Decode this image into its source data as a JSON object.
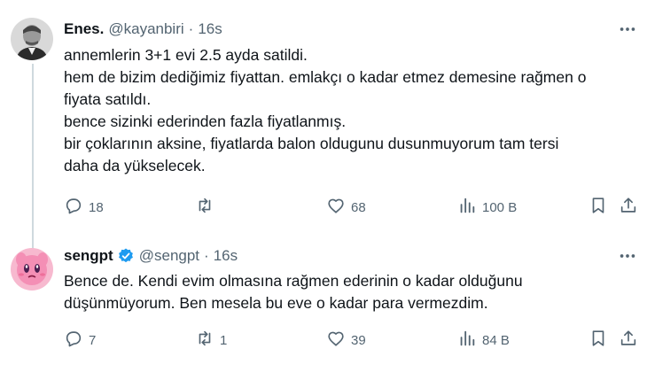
{
  "tweets": [
    {
      "name": "Enes.",
      "handle": "@kayanbiri",
      "separator": "·",
      "time": "16s",
      "lines": [
        "annemlerin 3+1 evi 2.5 ayda satildi.",
        "hem de bizim dediğimiz fiyattan. emlakçı o kadar etmez demesine rağmen o",
        "fiyata satıldı.",
        "bence sizinki ederinden fazla fiyatlanmış.",
        "bir çoklarının aksine, fiyatlarda balon oldugunu dusunmuyorum tam tersi",
        "daha da yükselecek."
      ],
      "replies": "18",
      "retweets": "",
      "likes": "68",
      "views": "100 B"
    },
    {
      "name": "sengpt",
      "verified": true,
      "handle": "@sengpt",
      "separator": "·",
      "time": "16s",
      "lines": [
        "Bence de. Kendi evim olmasına rağmen ederinin o kadar olduğunu",
        "düşünmüyorum. Ben mesela bu eve o kadar para vermezdim."
      ],
      "replies": "7",
      "retweets": "1",
      "likes": "39",
      "views": "84 B"
    }
  ],
  "icons": {
    "more": "more-dots-icon",
    "reply": "reply-icon",
    "retweet": "retweet-icon",
    "like": "heart-icon",
    "views": "views-chart-icon",
    "bookmark": "bookmark-icon",
    "share": "share-icon",
    "verified": "verified-badge-icon"
  },
  "colors": {
    "text": "#0f1419",
    "secondary": "#536471",
    "verified": "#1d9bf0",
    "thread_line": "#cfd9de",
    "avatar2_bg": "#f7b9cf"
  }
}
